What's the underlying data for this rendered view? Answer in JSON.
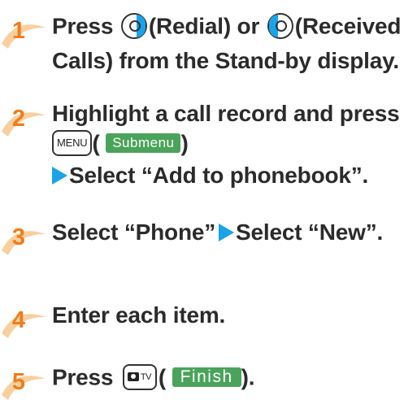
{
  "steps": [
    {
      "number": "1",
      "press": "Press",
      "redial_label": "(Redial) or",
      "received_label": "(Received",
      "line2": "Calls) from the Stand-by display.",
      "redial_key_icon": "circle-key-right-blue",
      "received_key_icon": "circle-key-left-blue"
    },
    {
      "number": "2",
      "line1": "Highlight a call record and press",
      "menu_key": "MENU",
      "softkey": "Submenu",
      "open_paren": "(",
      "close_paren": ")",
      "select_line": "Select “Add to phonebook”."
    },
    {
      "number": "3",
      "part1": "Select “Phone”",
      "part2": "Select “New”."
    },
    {
      "number": "4",
      "line1": "Enter each item."
    },
    {
      "number": "5",
      "press": "Press",
      "tv_label": "TV",
      "softkey": "Finish",
      "open_paren": "(",
      "close_paren": ")."
    }
  ],
  "colors": {
    "step_number": "#ef7d1a",
    "accent_blue": "#1aa3e8",
    "softkey_green": "#4aa35a"
  }
}
